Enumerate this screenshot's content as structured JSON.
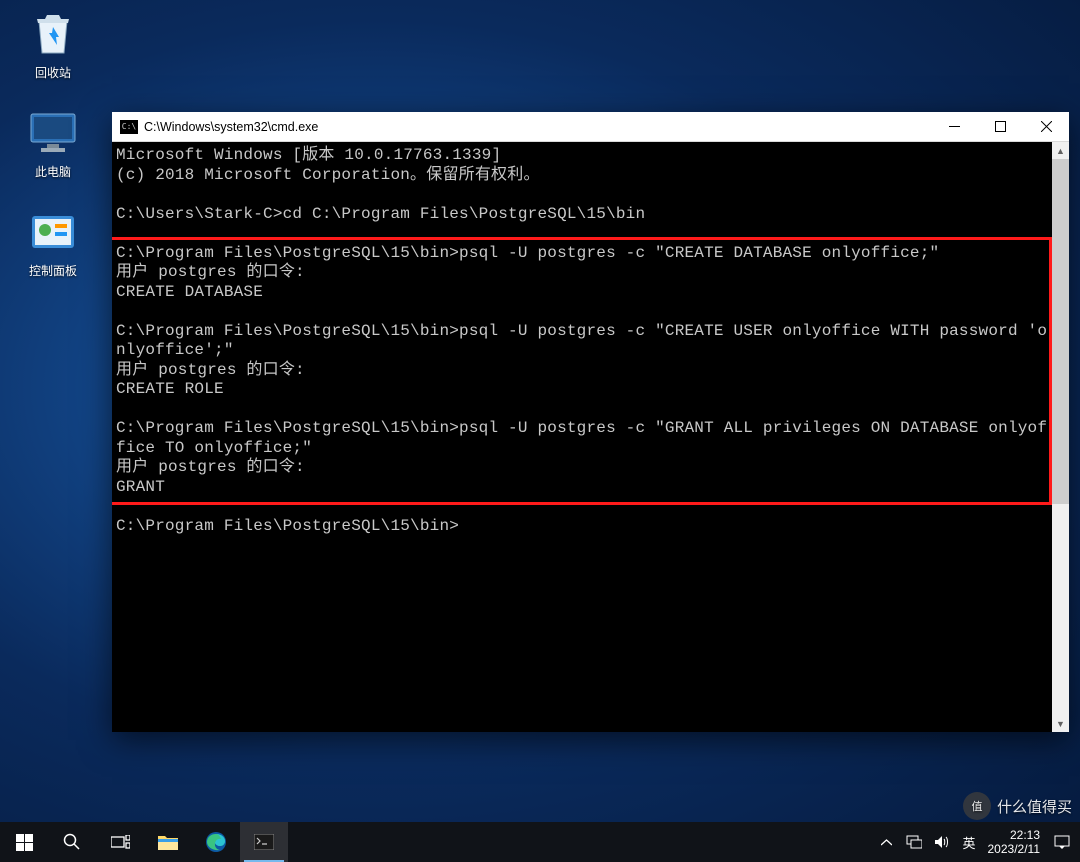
{
  "desktop": {
    "icons": [
      {
        "name": "recycle-bin",
        "label": "回收站"
      },
      {
        "name": "this-pc",
        "label": "此电脑"
      },
      {
        "name": "control-panel",
        "label": "控制面板"
      }
    ]
  },
  "cmd": {
    "title": "C:\\Windows\\system32\\cmd.exe",
    "lines": [
      "Microsoft Windows [版本 10.0.17763.1339]",
      "(c) 2018 Microsoft Corporation。保留所有权利。",
      "",
      "C:\\Users\\Stark-C>cd C:\\Program Files\\PostgreSQL\\15\\bin",
      "",
      "C:\\Program Files\\PostgreSQL\\15\\bin>psql -U postgres -c \"CREATE DATABASE onlyoffice;\"",
      "用户 postgres 的口令:",
      "CREATE DATABASE",
      "",
      "C:\\Program Files\\PostgreSQL\\15\\bin>psql -U postgres -c \"CREATE USER onlyoffice WITH password 'onlyoffice';\"",
      "用户 postgres 的口令:",
      "CREATE ROLE",
      "",
      "C:\\Program Files\\PostgreSQL\\15\\bin>psql -U postgres -c \"GRANT ALL privileges ON DATABASE onlyoffice TO onlyoffice;\"",
      "用户 postgres 的口令:",
      "GRANT",
      "",
      "C:\\Program Files\\PostgreSQL\\15\\bin>"
    ]
  },
  "taskbar": {
    "ime": "英",
    "time": "22:13",
    "date": "2023/2/11"
  },
  "watermark": {
    "text": "什么值得买",
    "badge": "值"
  }
}
